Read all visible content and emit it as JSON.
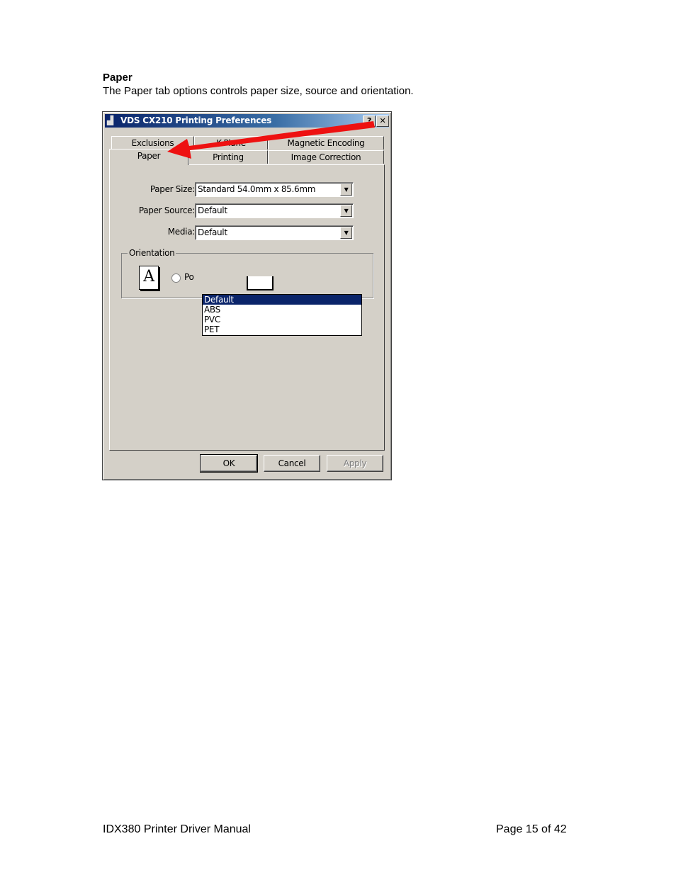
{
  "doc": {
    "heading": "Paper",
    "intro": "The Paper tab options controls paper size, source and orientation.",
    "footer_title": "IDX380 Printer Driver Manual",
    "footer_page": "Page 15 of 42"
  },
  "dialog": {
    "title": "VDS CX210 Printing Preferences",
    "help_label": "?",
    "close_label": "✕",
    "tabs_back": [
      "Exclusions",
      "K-Plane",
      "Magnetic Encoding"
    ],
    "tabs_front": [
      "Paper",
      "Printing",
      "Image Correction"
    ],
    "active_tab": "Paper",
    "paper_size_label": "Paper Size:",
    "paper_size_value": "Standard 54.0mm x 85.6mm",
    "paper_source_label": "Paper Source:",
    "paper_source_value": "Default",
    "media_label": "Media:",
    "media_value": "Default",
    "media_options": [
      "Default",
      "ABS",
      "PVC",
      "PET"
    ],
    "orientation_label": "Orientation",
    "portrait_label_partial": "Po",
    "portrait_icon_glyph": "A",
    "buttons": {
      "ok": "OK",
      "cancel": "Cancel",
      "apply": "Apply"
    }
  },
  "annotation": {
    "arrow_color": "#ee1111",
    "points_to": "Paper tab"
  }
}
